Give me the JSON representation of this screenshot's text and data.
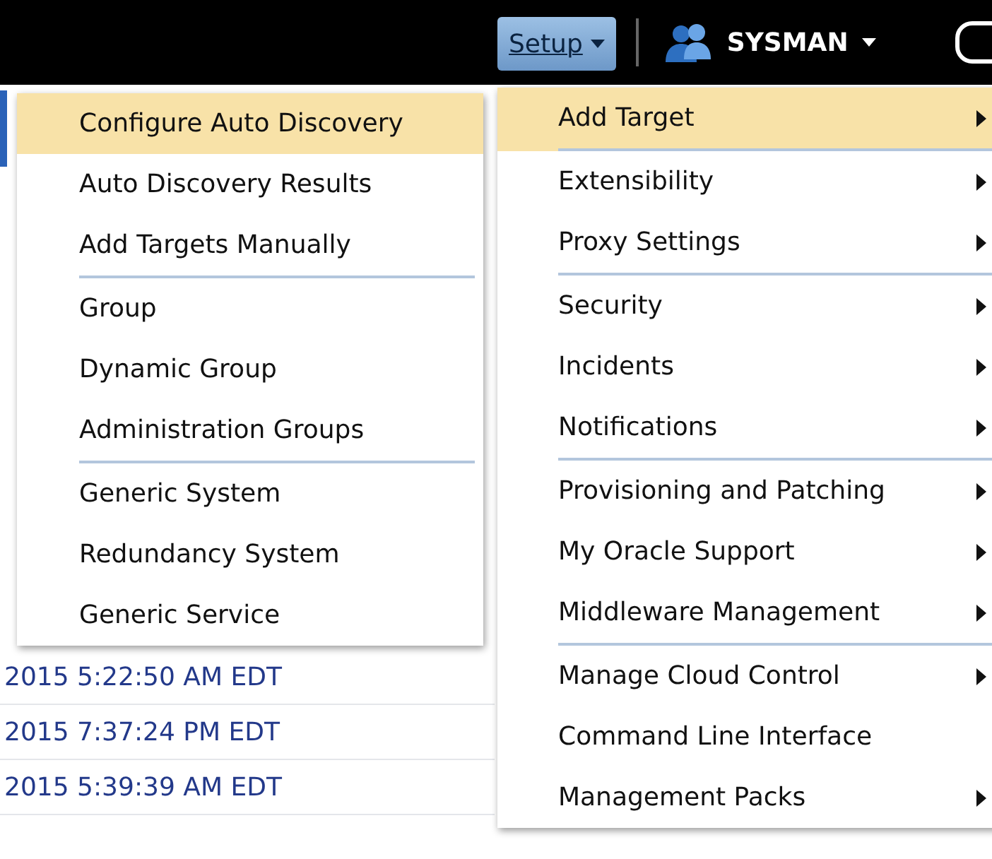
{
  "header": {
    "setup_menu": {
      "label": "Setup",
      "expanded": true
    },
    "user_menu": {
      "label": "SYSMAN"
    }
  },
  "background_rows": [
    "2015 5:22:50 AM EDT",
    "2015 7:37:24 PM EDT",
    "2015 5:39:39 AM EDT"
  ],
  "setup_menu_items": [
    {
      "label": "Add Target",
      "selected": true,
      "submenu": true,
      "separator_after": true
    },
    {
      "label": "Extensibility",
      "selected": false,
      "submenu": true,
      "separator_after": false
    },
    {
      "label": "Proxy Settings",
      "selected": false,
      "submenu": true,
      "separator_after": true
    },
    {
      "label": "Security",
      "selected": false,
      "submenu": true,
      "separator_after": false
    },
    {
      "label": "Incidents",
      "selected": false,
      "submenu": true,
      "separator_after": false
    },
    {
      "label": "Notifications",
      "selected": false,
      "submenu": true,
      "separator_after": true
    },
    {
      "label": "Provisioning and Patching",
      "selected": false,
      "submenu": true,
      "separator_after": false
    },
    {
      "label": "My Oracle Support",
      "selected": false,
      "submenu": true,
      "separator_after": false
    },
    {
      "label": "Middleware Management",
      "selected": false,
      "submenu": true,
      "separator_after": true
    },
    {
      "label": "Manage Cloud Control",
      "selected": false,
      "submenu": true,
      "separator_after": false
    },
    {
      "label": "Command Line Interface",
      "selected": false,
      "submenu": false,
      "separator_after": false
    },
    {
      "label": "Management Packs",
      "selected": false,
      "submenu": true,
      "separator_after": false
    }
  ],
  "add_target_submenu_items": [
    {
      "label": "Configure Auto Discovery",
      "selected": true,
      "separator_after": false
    },
    {
      "label": "Auto Discovery Results",
      "selected": false,
      "separator_after": false
    },
    {
      "label": "Add Targets Manually",
      "selected": false,
      "separator_after": true
    },
    {
      "label": "Group",
      "selected": false,
      "separator_after": false
    },
    {
      "label": "Dynamic Group",
      "selected": false,
      "separator_after": false
    },
    {
      "label": "Administration Groups",
      "selected": false,
      "separator_after": true
    },
    {
      "label": "Generic System",
      "selected": false,
      "separator_after": false
    },
    {
      "label": "Redundancy System",
      "selected": false,
      "separator_after": false
    },
    {
      "label": "Generic Service",
      "selected": false,
      "separator_after": false
    }
  ]
}
